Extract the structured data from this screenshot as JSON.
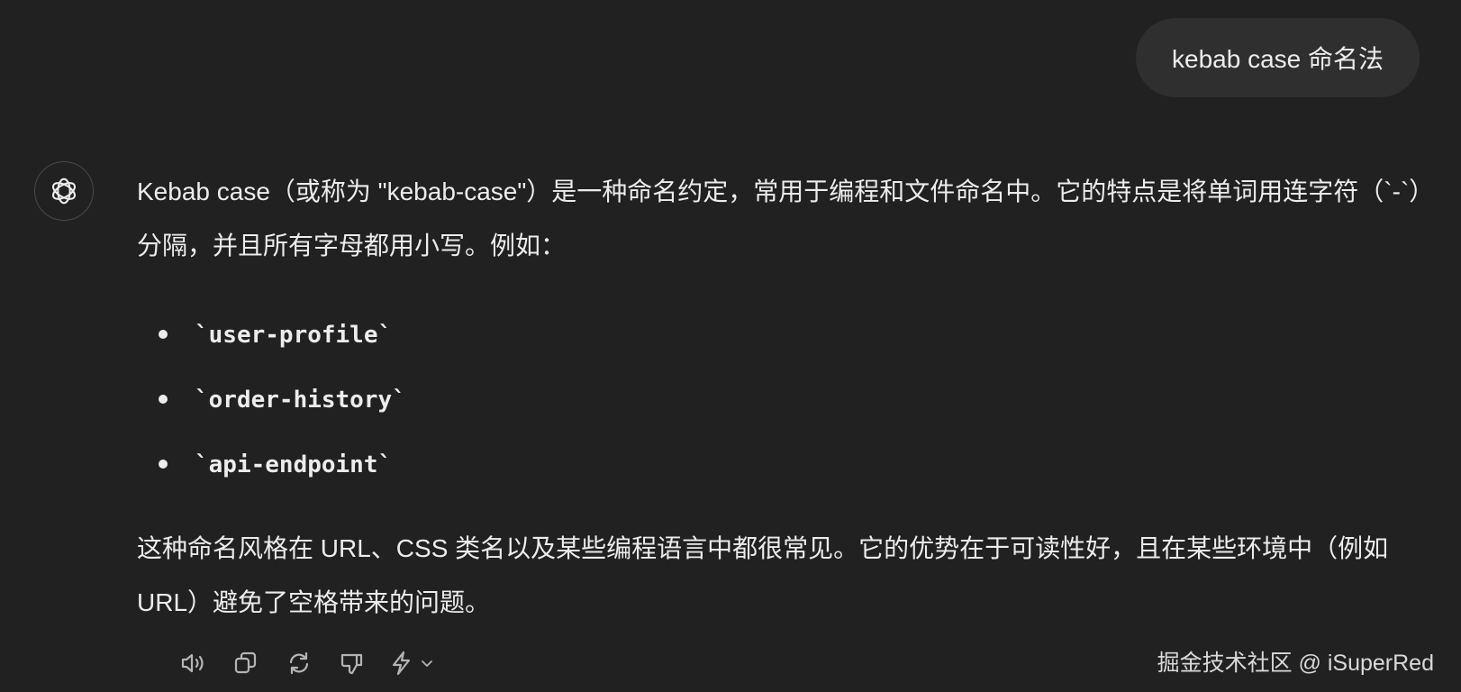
{
  "user_message": "kebab case 命名法",
  "assistant": {
    "intro": "Kebab case（或称为 \"kebab-case\"）是一种命名约定，常用于编程和文件命名中。它的特点是将单词用连字符（`-`）分隔，并且所有字母都用小写。例如：",
    "examples": [
      "`user-profile`",
      "`order-history`",
      "`api-endpoint`"
    ],
    "outro": "这种命名风格在 URL、CSS 类名以及某些编程语言中都很常见。它的优势在于可读性好，且在某些环境中（例如 URL）避免了空格带来的问题。"
  },
  "actions": {
    "icons": [
      "speaker-icon",
      "copy-icon",
      "regenerate-icon",
      "thumbs-down-icon",
      "lightning-icon",
      "chevron-down-icon"
    ]
  },
  "watermark": "掘金技术社区 @ iSuperRed",
  "colors": {
    "background": "#212121",
    "user_bubble": "#2f2f2f",
    "text": "#ececec",
    "icon": "#b4b4b4"
  }
}
